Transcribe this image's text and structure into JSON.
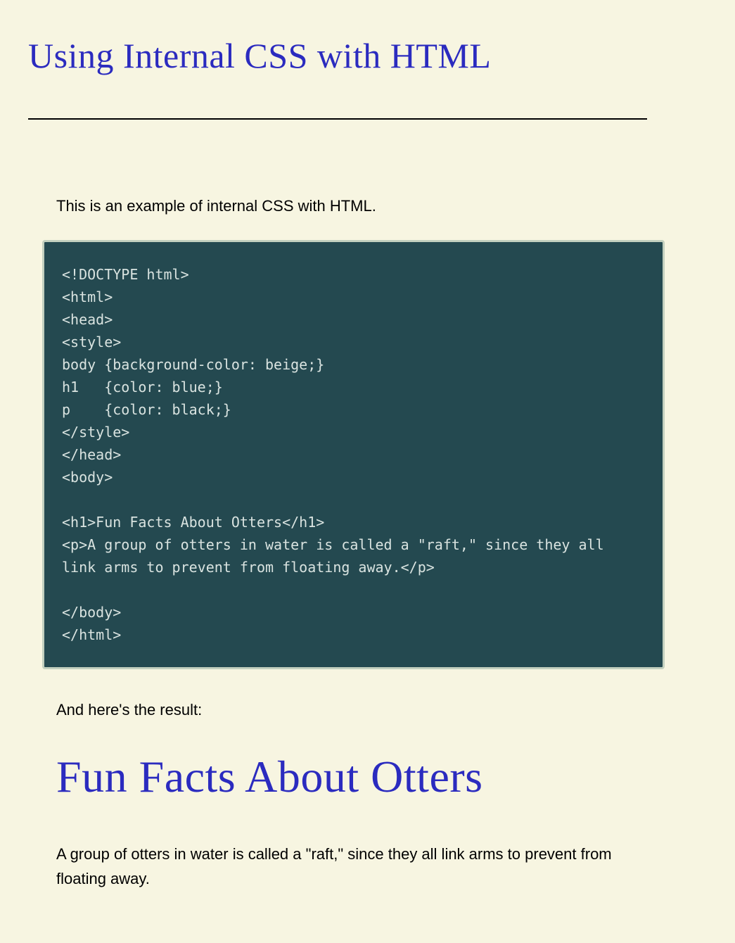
{
  "title": "Using Internal CSS with HTML",
  "intro": "This is an example of internal CSS with HTML.",
  "code": "<!DOCTYPE html>\n<html>\n<head>\n<style>\nbody {background-color: beige;}\nh1   {color: blue;}\np    {color: black;}\n</style>\n</head>\n<body>\n\n<h1>Fun Facts About Otters</h1>\n<p>A group of otters in water is called a \"raft,\" since they all link arms to prevent from floating away.</p>\n\n</body>\n</html>",
  "result_label": "And here's the result:",
  "result": {
    "heading": "Fun Facts About Otters",
    "paragraph": "A group of otters in water is called a \"raft,\" since they all link arms to prevent from floating away."
  }
}
